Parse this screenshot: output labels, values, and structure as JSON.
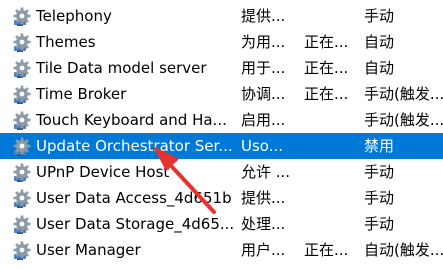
{
  "services": [
    {
      "name": "Telephony",
      "description": "提供...",
      "status": "",
      "startup": "手动",
      "selected": false
    },
    {
      "name": "Themes",
      "description": "为用...",
      "status": "正在...",
      "startup": "自动",
      "selected": false
    },
    {
      "name": "Tile Data model server",
      "description": "用于...",
      "status": "正在...",
      "startup": "自动",
      "selected": false
    },
    {
      "name": "Time Broker",
      "description": "协调...",
      "status": "正在...",
      "startup": "手动(触发...",
      "selected": false
    },
    {
      "name": "Touch Keyboard and Ha...",
      "description": "启用...",
      "status": "",
      "startup": "手动(触发...",
      "selected": false
    },
    {
      "name": "Update Orchestrator Ser...",
      "description": "Uso...",
      "status": "",
      "startup": "禁用",
      "selected": true
    },
    {
      "name": "UPnP Device Host",
      "description": "允许 ...",
      "status": "",
      "startup": "手动",
      "selected": false
    },
    {
      "name": "User Data Access_4d651b",
      "description": "提供...",
      "status": "",
      "startup": "手动",
      "selected": false
    },
    {
      "name": "User Data Storage_4d65...",
      "description": "处理...",
      "status": "",
      "startup": "手动",
      "selected": false
    },
    {
      "name": "User Manager",
      "description": "用户...",
      "status": "正在...",
      "startup": "自动(触发...",
      "selected": false
    }
  ],
  "colors": {
    "selection": "#0078d7",
    "annotation_arrow": "#e8322d"
  },
  "icons": {
    "service": "gear-icon"
  }
}
